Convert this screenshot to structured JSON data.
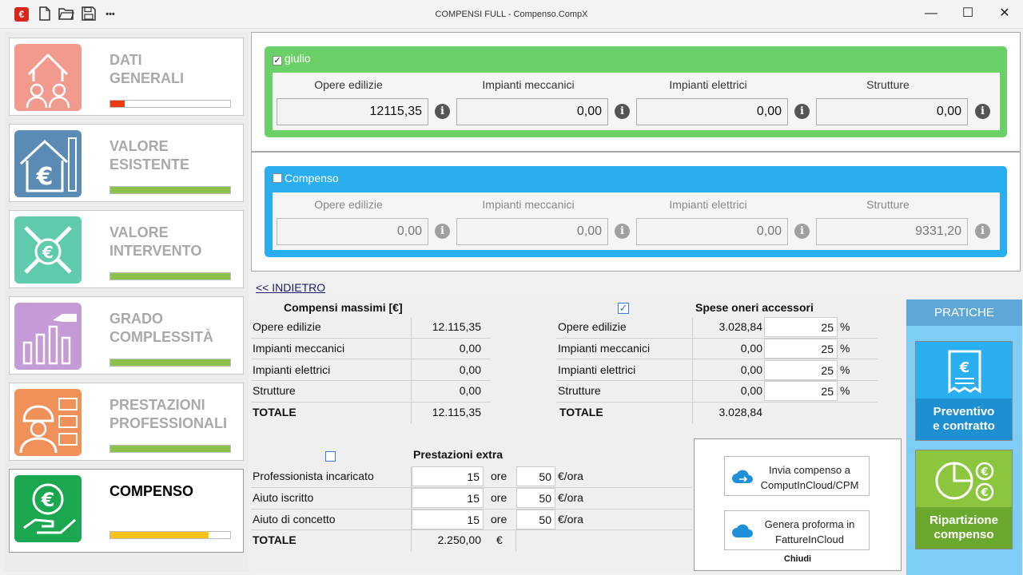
{
  "window": {
    "title": "COMPENSI FULL - Compenso.CompX",
    "controls": {
      "minimize": "—",
      "maximize": "☐",
      "close": "✕"
    }
  },
  "toolbar": {
    "icons": [
      "app-logo-icon",
      "new-file-icon",
      "open-folder-icon",
      "save-icon",
      "more-icon"
    ],
    "more_label": "•••"
  },
  "sidebar": {
    "items": [
      {
        "label": "DATI\nGENERALI",
        "progress": 0.12,
        "color": "#ee3b14",
        "icon_color": "#f29a8e",
        "active": false
      },
      {
        "label": "VALORE\nESISTENTE",
        "progress": 1.0,
        "color": "#8bc34a",
        "icon_color": "#5a8bb4",
        "active": false
      },
      {
        "label": "VALORE\nINTERVENTO",
        "progress": 1.0,
        "color": "#8bc34a",
        "icon_color": "#5fcaae",
        "active": false
      },
      {
        "label": "GRADO\nCOMPLESSITÀ",
        "progress": 1.0,
        "color": "#8bc34a",
        "icon_color": "#c49bd6",
        "active": false
      },
      {
        "label": "PRESTAZIONI\nPROFESSIONALI",
        "progress": 1.0,
        "color": "#8bc34a",
        "icon_color": "#ef9159",
        "active": false
      },
      {
        "label": "COMPENSO",
        "progress": 0.82,
        "color": "#f7c31a",
        "icon_color": "#1ba750",
        "active": true
      }
    ]
  },
  "panel_giulio": {
    "title": "giulio",
    "checked": true,
    "columns": [
      "Opere edilizie",
      "Impianti meccanici",
      "Impianti elettrici",
      "Strutture"
    ],
    "values": [
      "12115,35",
      "0,00",
      "0,00",
      "0,00"
    ],
    "color": "#6bd068"
  },
  "panel_compenso": {
    "title": "Compenso",
    "checked": false,
    "columns": [
      "Opere edilizie",
      "Impianti meccanici",
      "Impianti elettrici",
      "Strutture"
    ],
    "values": [
      "0,00",
      "0,00",
      "0,00",
      "9331,20"
    ],
    "color": "#29aef0"
  },
  "back_link": "<< INDIETRO",
  "compensi": {
    "title": "Compensi massimi [€]",
    "rows": [
      {
        "label": "Opere edilizie",
        "value": "12.115,35"
      },
      {
        "label": "Impianti meccanici",
        "value": "0,00"
      },
      {
        "label": "Impianti elettrici",
        "value": "0,00"
      },
      {
        "label": "Strutture",
        "value": "0,00"
      }
    ],
    "total_label": "TOTALE",
    "total_value": "12.115,35"
  },
  "spese": {
    "title": "Spese oneri accessori",
    "checked": true,
    "checkmark": "✓",
    "rows": [
      {
        "label": "Opere edilizie",
        "value": "3.028,84",
        "percent": "25",
        "unit": "%"
      },
      {
        "label": "Impianti meccanici",
        "value": "0,00",
        "percent": "25",
        "unit": "%"
      },
      {
        "label": "Impianti elettrici",
        "value": "0,00",
        "percent": "25",
        "unit": "%"
      },
      {
        "label": "Strutture",
        "value": "0,00",
        "percent": "25",
        "unit": "%"
      }
    ],
    "total_label": "TOTALE",
    "total_value": "3.028,84"
  },
  "extra": {
    "title": "Prestazioni extra",
    "checked": false,
    "rows": [
      {
        "label": "Professionista incaricato",
        "hours": "15",
        "hours_unit": "ore",
        "rate": "50",
        "rate_unit": "€/ora"
      },
      {
        "label": "Aiuto iscritto",
        "hours": "15",
        "hours_unit": "ore",
        "rate": "50",
        "rate_unit": "€/ora"
      },
      {
        "label": "Aiuto di concetto",
        "hours": "15",
        "hours_unit": "ore",
        "rate": "50",
        "rate_unit": "€/ora"
      }
    ],
    "total_label": "TOTALE",
    "total_value": "2.250,00",
    "currency": "€"
  },
  "cloud_popup": {
    "btn1": {
      "line1": "Invia compenso a",
      "line2": "ComputInCloud/CPM"
    },
    "btn2": {
      "line1": "Genera proforma in",
      "line2": "FattureInCloud"
    },
    "close": "Chiudi"
  },
  "pratiche": {
    "header": "PRATICHE",
    "btn1": {
      "line1": "Preventivo",
      "line2": "e contratto"
    },
    "btn2": {
      "line1": "Ripartizione",
      "line2": "compenso"
    },
    "euro": "€",
    "accent_blue": "#29aef0",
    "accent_green": "#8cc63f"
  }
}
